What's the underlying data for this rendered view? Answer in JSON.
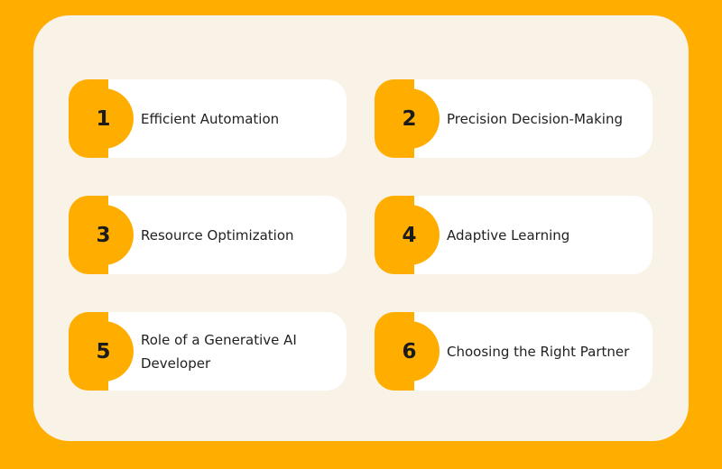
{
  "colors": {
    "background": "#FFAE00",
    "panel": "#F9F2E6",
    "card": "#FFFFFF",
    "accent": "#FFAE00",
    "text": "#222222"
  },
  "items": [
    {
      "number": "1",
      "label": "Efficient Automation"
    },
    {
      "number": "2",
      "label": "Precision Decision-Making"
    },
    {
      "number": "3",
      "label": "Resource Optimization"
    },
    {
      "number": "4",
      "label": "Adaptive Learning"
    },
    {
      "number": "5",
      "label": "Role of a Generative AI Developer"
    },
    {
      "number": "6",
      "label": "Choosing the Right Partner"
    }
  ]
}
